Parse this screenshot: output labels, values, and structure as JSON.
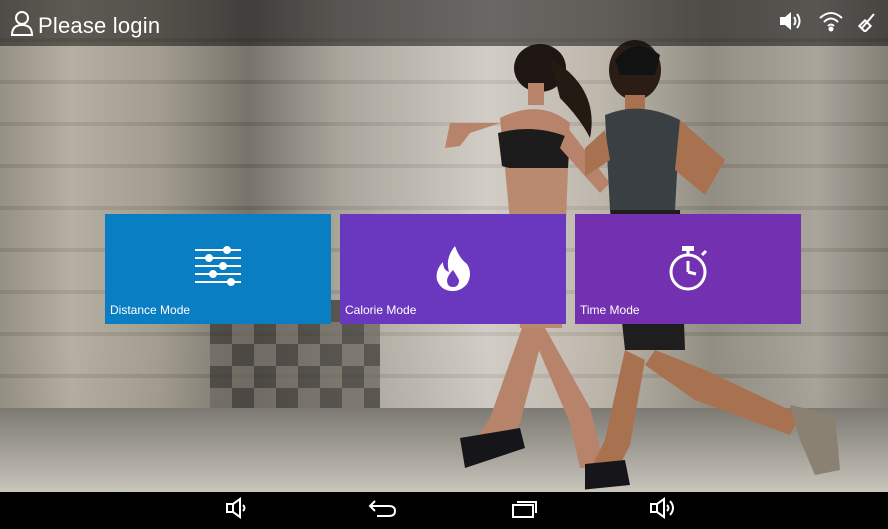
{
  "status_bar": {
    "login_label": "Please login",
    "icons": [
      "user-icon",
      "speaker-icon",
      "wifi-icon",
      "signal-icon"
    ]
  },
  "tiles": [
    {
      "label": "Distance Mode",
      "icon": "sliders-icon",
      "color": "#0a7ec2"
    },
    {
      "label": "Calorie Mode",
      "icon": "flame-icon",
      "color": "#6a38bf"
    },
    {
      "label": "Time Mode",
      "icon": "stopwatch-icon",
      "color": "#7330b0"
    }
  ],
  "nav_bar": {
    "buttons": [
      "volume-down-icon",
      "back-icon",
      "recent-apps-icon",
      "volume-up-icon"
    ]
  }
}
